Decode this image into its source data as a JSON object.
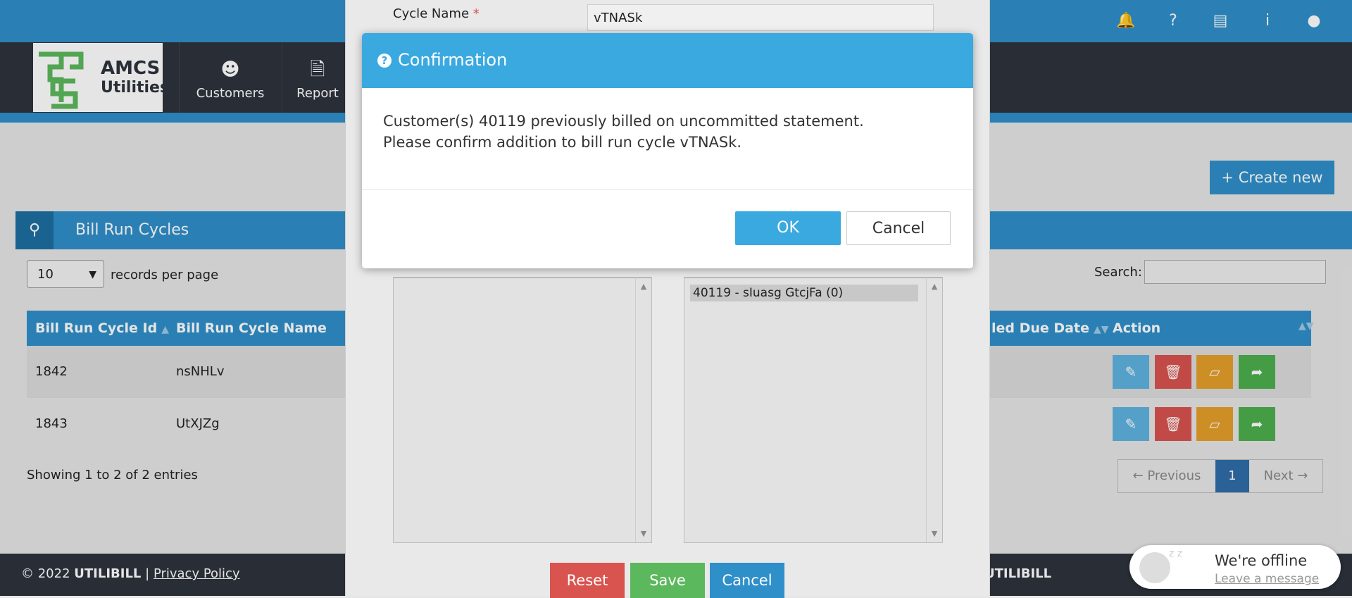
{
  "navbar": {
    "items": [
      {
        "label": "Customers",
        "icon": "user-icon"
      },
      {
        "label": "Report",
        "icon": "document-icon"
      }
    ]
  },
  "logo": {
    "line1": "AMCS",
    "line2": "Utilities"
  },
  "page": {
    "create_button": "Create new",
    "panel_title": "Bill Run Cycles",
    "records_per_page_value": "10",
    "records_per_page_label": "records per page",
    "search_label": "Search:",
    "showing": "Showing 1 to 2 of 2 entries"
  },
  "table": {
    "columns": [
      "Bill Run Cycle Id",
      "Bill Run Cycle Name",
      "led Due Date",
      "Action"
    ],
    "rows": [
      {
        "id": "1842",
        "name": "nsNHLv"
      },
      {
        "id": "1843",
        "name": "UtXJZg"
      }
    ]
  },
  "pagination": {
    "previous": "← Previous",
    "current": "1",
    "next": "Next →"
  },
  "footer": {
    "copyright": "© 2022",
    "brand": "UTILIBILL",
    "separator": "|",
    "privacy": "Privacy Policy",
    "brand_right": "UTILIBILL"
  },
  "edit_modal": {
    "cycle_name_label": "Cycle Name",
    "required_mark": "*",
    "cycle_name_value": "vTNASk",
    "right_list": [
      "40119 - sIuasg GtcjFa (0)"
    ],
    "buttons": {
      "reset": "Reset",
      "save": "Save",
      "cancel": "Cancel"
    }
  },
  "dialog": {
    "title": "Confirmation",
    "line1": "Customer(s) 40119 previously billed on uncommitted statement.",
    "line2": "Please confirm addition to bill run cycle vTNASk.",
    "ok": "OK",
    "cancel": "Cancel"
  },
  "chat": {
    "status": "We're offline",
    "link": "Leave a message"
  },
  "colors": {
    "primary": "#2f8fc9",
    "dialog_header": "#39a9e0",
    "danger": "#d9534f",
    "warning": "#e5a02a",
    "success": "#4cae4c",
    "dark": "#2d333d"
  }
}
